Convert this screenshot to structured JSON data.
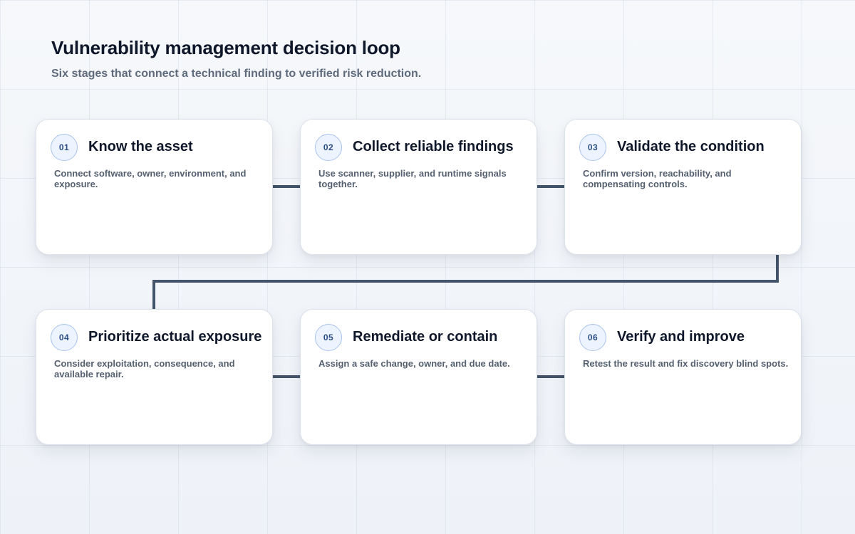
{
  "header": {
    "title": "Vulnerability management decision loop",
    "subtitle": "Six stages that connect a technical finding to verified risk reduction."
  },
  "stages": [
    {
      "number": "01",
      "title": "Know the asset",
      "description": "Connect software, owner, environment, and exposure."
    },
    {
      "number": "02",
      "title": "Collect reliable findings",
      "description": "Use scanner, supplier, and runtime signals together."
    },
    {
      "number": "03",
      "title": "Validate the condition",
      "description": "Confirm version, reachability, and compensating controls."
    },
    {
      "number": "04",
      "title": "Prioritize actual exposure",
      "description": "Consider exploitation, consequence, and available repair."
    },
    {
      "number": "05",
      "title": "Remediate or contain",
      "description": "Assign a safe change, owner, and due date."
    },
    {
      "number": "06",
      "title": "Verify and improve",
      "description": "Retest the result and fix discovery blind spots."
    }
  ],
  "colors": {
    "connector": "#44546a",
    "badge_border": "#a9c3ee",
    "badge_text": "#2c4f86",
    "title_text": "#0f172a",
    "body_text": "#556070"
  }
}
